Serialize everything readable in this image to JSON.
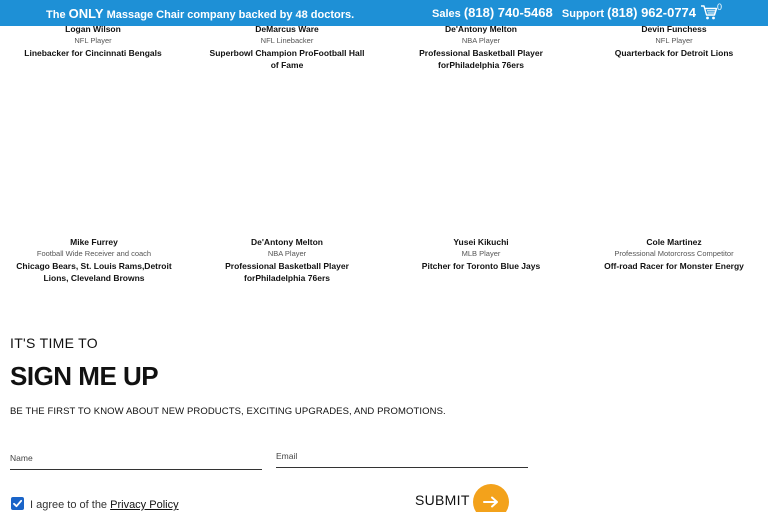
{
  "topbar": {
    "promo_pre": "The ",
    "promo_only": "ONLY",
    "promo_post": " Massage Chair company backed by 48 doctors.",
    "sales_label": "Sales ",
    "sales_number": "(818) 740-5468",
    "support_label": "Support ",
    "support_number": "(818) 962-0774",
    "cart_count": "0"
  },
  "athletes_row1": [
    {
      "name": "Logan Wilson",
      "role": "NFL Player",
      "desc": "Linebacker for Cincinnati Bengals"
    },
    {
      "name": "DeMarcus Ware",
      "role": "NFL Linebacker",
      "desc": "Superbowl Champion ProFootball Hall of Fame"
    },
    {
      "name": "De'Antony Melton",
      "role": "NBA Player",
      "desc": "Professional Basketball Player forPhiladelphia 76ers"
    },
    {
      "name": "Devin Funchess",
      "role": "NFL Player",
      "desc": "Quarterback for Detroit Lions"
    }
  ],
  "athletes_row2": [
    {
      "name": "Mike Furrey",
      "role": "Football Wide Receiver and coach",
      "desc": "Chicago Bears, St. Louis Rams,Detroit Lions, Cleveland Browns"
    },
    {
      "name": "De'Antony Melton",
      "role": "NBA Player",
      "desc": "Professional Basketball Player forPhiladelphia 76ers"
    },
    {
      "name": "Yusei Kikuchi",
      "role": "MLB Player",
      "desc": "Pitcher for Toronto Blue Jays"
    },
    {
      "name": "Cole Martinez",
      "role": "Professional Motorcross Competitor",
      "desc": "Off-road Racer for Monster Energy"
    }
  ],
  "signup": {
    "kicker": "IT'S TIME TO",
    "title": "SIGN ME UP",
    "subtitle": "BE THE FIRST TO KNOW ABOUT NEW PRODUCTS, EXCITING UPGRADES, AND PROMOTIONS.",
    "name_placeholder": "Name",
    "email_placeholder": "Email",
    "agree_text": "I agree to of the ",
    "privacy_link": "Privacy Policy",
    "submit_label": "SUBMIT"
  },
  "colors": {
    "topbar": "#1e90d6",
    "accent": "#f3a21b",
    "checkbox": "#1a64c8"
  }
}
